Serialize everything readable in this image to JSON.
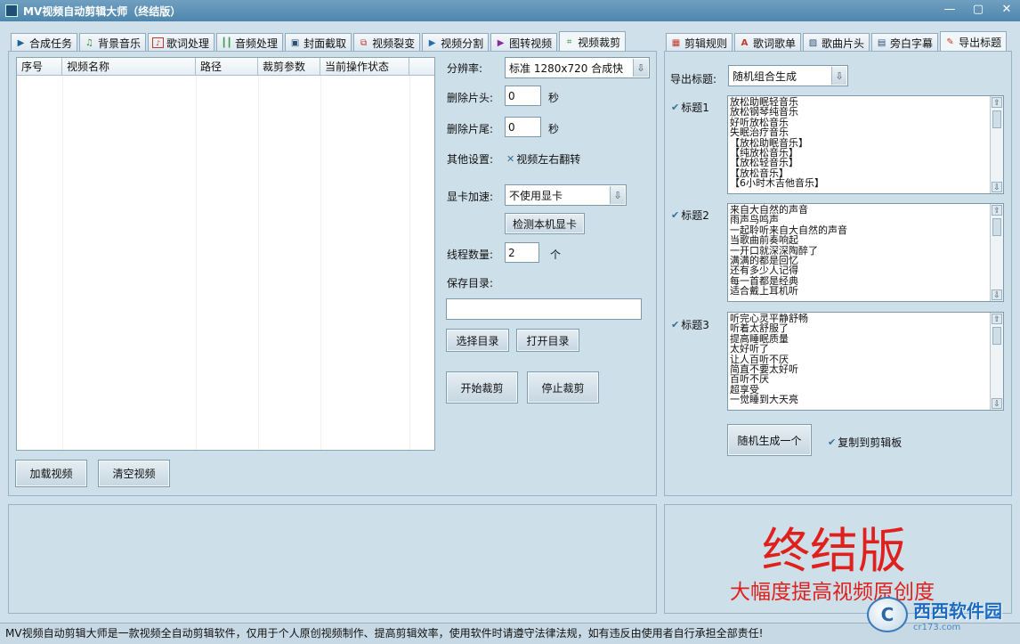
{
  "window": {
    "title": "MV视频自动剪辑大师（终结版）"
  },
  "left_tabs": [
    {
      "label": "合成任务",
      "icon": "play-icon"
    },
    {
      "label": "背景音乐",
      "icon": "music-note-icon"
    },
    {
      "label": "歌词处理",
      "icon": "lyrics-icon"
    },
    {
      "label": "音频处理",
      "icon": "waveform-icon"
    },
    {
      "label": "封面截取",
      "icon": "image-icon"
    },
    {
      "label": "视频裂变",
      "icon": "split-icon"
    },
    {
      "label": "视频分割",
      "icon": "film-icon"
    },
    {
      "label": "图转视频",
      "icon": "image-to-video-icon"
    },
    {
      "label": "视频裁剪",
      "icon": "crop-icon"
    }
  ],
  "right_tabs": [
    {
      "label": "剪辑规则",
      "icon": "film-strip-icon"
    },
    {
      "label": "歌词歌单",
      "icon": "text-a-icon"
    },
    {
      "label": "歌曲片头",
      "icon": "picture-icon"
    },
    {
      "label": "旁白字幕",
      "icon": "document-icon"
    },
    {
      "label": "导出标题",
      "icon": "edit-icon"
    }
  ],
  "table": {
    "columns": [
      "序号",
      "视频名称",
      "路径",
      "裁剪参数",
      "当前操作状态"
    ]
  },
  "left_buttons": {
    "load": "加载视频",
    "clear": "清空视频"
  },
  "form": {
    "resolution_label": "分辨率:",
    "resolution_value": "标准 1280x720  合成快",
    "trim_head_label": "删除片头:",
    "trim_head_value": "0",
    "trim_tail_label": "删除片尾:",
    "trim_tail_value": "0",
    "seconds_unit": "秒",
    "other_label": "其他设置:",
    "flip_option": "视频左右翻转",
    "gpu_label": "显卡加速:",
    "gpu_value": "不使用显卡",
    "detect_gpu_button": "检测本机显卡",
    "threads_label": "线程数量:",
    "threads_value": "2",
    "threads_unit": "个",
    "save_dir_label": "保存目录:",
    "save_dir_value": "",
    "choose_dir_button": "选择目录",
    "open_dir_button": "打开目录",
    "start_button": "开始裁剪",
    "stop_button": "停止裁剪"
  },
  "export": {
    "title_label": "导出标题:",
    "title_mode": "随机组合生成",
    "groups": [
      {
        "label": "标题1",
        "lines": [
          "放松助眠轻音乐",
          "放松钢琴纯音乐",
          "好听放松音乐",
          "失眠治疗音乐",
          "【放松助眠音乐】",
          "【纯放松音乐】",
          "【放松轻音乐】",
          "【放松音乐】",
          "【6小时木吉他音乐】"
        ]
      },
      {
        "label": "标题2",
        "lines": [
          "来自大自然的声音",
          "雨声鸟鸣声",
          "一起聆听来自大自然的声音",
          "当歌曲前奏响起",
          "一开口就深深陶醉了",
          "满满的都是回忆",
          "还有多少人记得",
          "每一首都是经典",
          "适合戴上耳机听"
        ]
      },
      {
        "label": "标题3",
        "lines": [
          "听完心灵平静舒畅",
          "听着太舒服了",
          "提高睡眠质量",
          "太好听了",
          "让人百听不厌",
          "简直不要太好听",
          "百听不厌",
          "超享受",
          "一觉睡到大天亮"
        ]
      }
    ],
    "generate_button": "随机生成一个",
    "copy_option": "复制到剪辑板"
  },
  "promo": {
    "headline": "终结版",
    "subline": "大幅度提高视频原创度"
  },
  "status_text": "MV视频自动剪辑大师是一款视频全自动剪辑软件，仅用于个人原创视频制作、提高剪辑效率，使用软件时请遵守法律法规，如有违反由使用者自行承担全部责任!",
  "watermark": {
    "logo": "C",
    "name": "西西软件园",
    "domain": "cr173.com"
  }
}
